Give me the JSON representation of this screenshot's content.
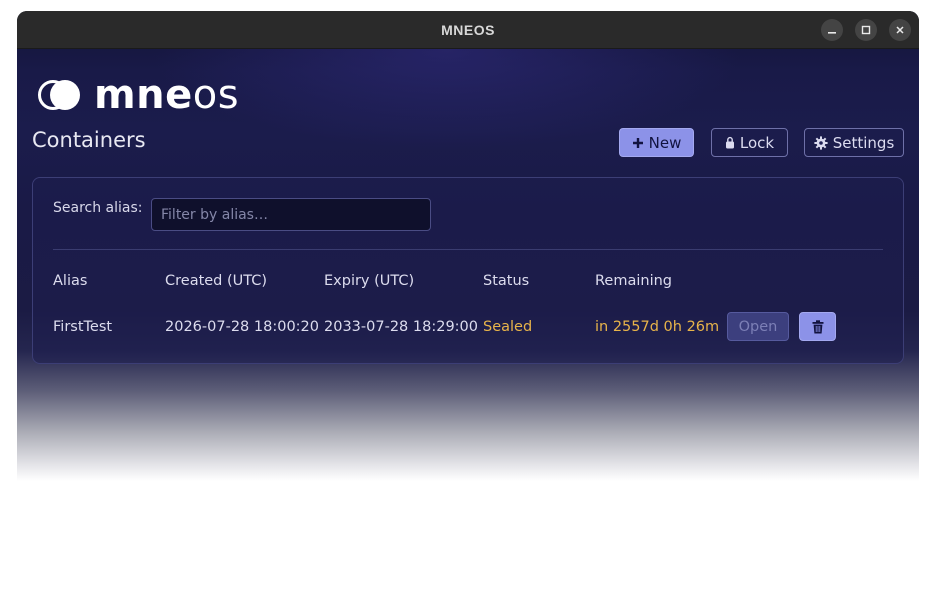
{
  "window": {
    "title": "MNEOS"
  },
  "logo": {
    "text_bold": "mne",
    "text_thin": "os"
  },
  "header": {
    "title": "Containers"
  },
  "toolbar": {
    "new_label": "New",
    "lock_label": "Lock",
    "settings_label": "Settings"
  },
  "search": {
    "label": "Search alias:",
    "placeholder": "Filter by alias…",
    "value": ""
  },
  "table": {
    "columns": [
      "Alias",
      "Created (UTC)",
      "Expiry (UTC)",
      "Status",
      "Remaining"
    ],
    "rows": [
      {
        "alias": "FirstTest",
        "created": "2026-07-28 18:00:20",
        "expiry": "2033-07-28 18:29:00",
        "status": "Sealed",
        "remaining": "in 2557d 0h 26m",
        "open_label": "Open"
      }
    ]
  },
  "colors": {
    "accent": "#8c92e8",
    "status_sealed": "#e8b44a",
    "background": "#1b1c4c"
  },
  "icons": {
    "new": "plus-icon",
    "lock": "lock-icon",
    "settings": "gear-icon",
    "delete": "trash-icon"
  }
}
